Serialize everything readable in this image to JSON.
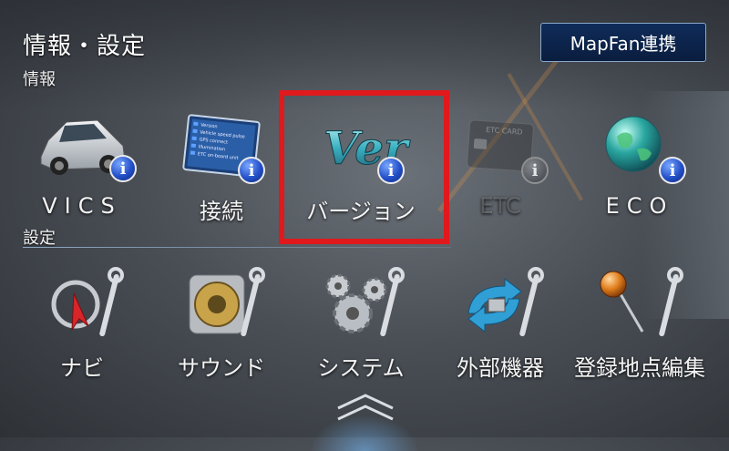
{
  "header": {
    "title": "情報・設定",
    "mapfan_button": "MapFan連携"
  },
  "sections": {
    "info": "情報",
    "settings": "設定"
  },
  "info_tiles": [
    {
      "label": "VICS",
      "icon": "car-icon",
      "badge": "i"
    },
    {
      "label": "接続",
      "icon": "connection-screen-icon",
      "badge": "i"
    },
    {
      "label": "バージョン",
      "icon": "version-ver-icon",
      "badge": "i",
      "highlighted": true
    },
    {
      "label": "ETC",
      "icon": "etc-card-icon",
      "badge": "i",
      "disabled": true
    },
    {
      "label": "ECO",
      "icon": "globe-icon",
      "badge": "i"
    }
  ],
  "settings_tiles": [
    {
      "label": "ナビ",
      "icon": "navi-wrench-icon"
    },
    {
      "label": "サウンド",
      "icon": "speaker-wrench-icon"
    },
    {
      "label": "システム",
      "icon": "gears-wrench-icon"
    },
    {
      "label": "外部機器",
      "icon": "external-device-wrench-icon"
    },
    {
      "label": "登録地点編集",
      "icon": "pin-wrench-icon"
    }
  ],
  "connection_screen_lines": [
    "Version",
    "Vehicle speed pulse",
    "GPS connect",
    "Illumination",
    "ETC on-board unit"
  ],
  "etc_card_text": "ETC CARD",
  "version_icon_text": "Ver",
  "colors": {
    "highlight": "#e0191d",
    "button_bg": "#0f2c5a",
    "badge": "#2450c9"
  }
}
